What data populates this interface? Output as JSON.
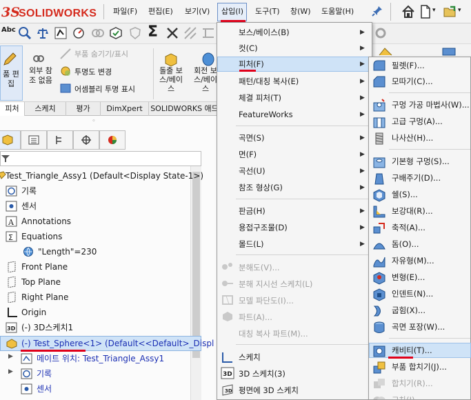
{
  "app": {
    "logo_ds": "3S",
    "logo_name": "SOLIDWORKS"
  },
  "menubar": [
    "파일(F)",
    "편집(E)",
    "보기(V)",
    "삽입(I)",
    "도구(T)",
    "창(W)",
    "도움말(H)"
  ],
  "toolbar1": {
    "abc_label": "Abc"
  },
  "ribbon": {
    "edit_part": "품 편\n집",
    "external_ref": "외부 참\n조 없음",
    "hide_show_parts": "부품 숨기기/표시",
    "change_transparency": "투명도 변경",
    "assembly_transparency": "어셈블리 투명 표시",
    "extrude_boss": "돌출 보\n스/베이\n스",
    "revolve_boss": "회전 보\n스/베이\n스"
  },
  "tabs": [
    "피처",
    "스케치",
    "평가",
    "DimXpert",
    "SOLIDWORKS 애드"
  ],
  "tree": [
    "Test_Triangle_Assy1  (Default<Display State-1>)",
    "기록",
    "센서",
    "Annotations",
    "Equations",
    "\"Length\"=230",
    "Front Plane",
    "Top Plane",
    "Right Plane",
    "Origin",
    "(-) 3D스케치1",
    "(-) Test_Sphere<1>  (Default<<Default>_Displ",
    "메이트 위치: Test_Triangle_Assy1",
    "기록",
    "센서"
  ],
  "insert_menu": [
    {
      "label": "보스/베이스(B)",
      "sub": true,
      "enabled": true
    },
    {
      "label": "컷(C)",
      "sub": true,
      "enabled": true
    },
    {
      "label": "피처(F)",
      "sub": true,
      "enabled": true
    },
    {
      "label": "패턴/대칭 복사(E)",
      "sub": true,
      "enabled": true
    },
    {
      "label": "체결 피처(T)",
      "sub": true,
      "enabled": true
    },
    {
      "label": "FeatureWorks",
      "sub": true,
      "enabled": true
    },
    {
      "label": "곡면(S)",
      "sub": true,
      "enabled": true
    },
    {
      "label": "면(F)",
      "sub": true,
      "enabled": true
    },
    {
      "label": "곡선(U)",
      "sub": true,
      "enabled": true
    },
    {
      "label": "참조 형상(G)",
      "sub": true,
      "enabled": true
    },
    {
      "label": "판금(H)",
      "sub": true,
      "enabled": true
    },
    {
      "label": "용접구조물(D)",
      "sub": true,
      "enabled": true
    },
    {
      "label": "몰드(L)",
      "sub": true,
      "enabled": true
    },
    {
      "label": "분해도(V)...",
      "sub": false,
      "enabled": false
    },
    {
      "label": "분해 지시선 스케치(L)",
      "sub": false,
      "enabled": false
    },
    {
      "label": "모델 파단도(I)...",
      "sub": false,
      "enabled": false
    },
    {
      "label": "파트(A)...",
      "sub": false,
      "enabled": false
    },
    {
      "label": "대칭 복사 파트(M)...",
      "sub": false,
      "enabled": false
    },
    {
      "label": "스케치",
      "sub": false,
      "enabled": true
    },
    {
      "label": "3D 스케치(3)",
      "sub": false,
      "enabled": true
    },
    {
      "label": "평면에 3D 스케치",
      "sub": false,
      "enabled": true
    }
  ],
  "feature_menu": [
    {
      "label": "필렛(F)...",
      "enabled": true
    },
    {
      "label": "모따기(C)...",
      "enabled": true
    },
    {
      "label": "구멍 가공 마법사(W)...",
      "enabled": true
    },
    {
      "label": "고급 구멍(A)...",
      "enabled": true
    },
    {
      "label": "나사산(H)...",
      "enabled": true
    },
    {
      "label": "기본형 구멍(S)...",
      "enabled": true
    },
    {
      "label": "구배주기(D)...",
      "enabled": true
    },
    {
      "label": "쉘(S)...",
      "enabled": true
    },
    {
      "label": "보강대(R)...",
      "enabled": true
    },
    {
      "label": "축적(A)...",
      "enabled": true
    },
    {
      "label": "돔(O)...",
      "enabled": true
    },
    {
      "label": "자유형(M)...",
      "enabled": true
    },
    {
      "label": "변형(E)...",
      "enabled": true
    },
    {
      "label": "인덴트(N)...",
      "enabled": true
    },
    {
      "label": "굽힘(X)...",
      "enabled": true
    },
    {
      "label": "곡면 포장(W)...",
      "enabled": true
    },
    {
      "label": "캐비티(T)...",
      "enabled": true
    },
    {
      "label": "부품 합치기(J)...",
      "enabled": true
    },
    {
      "label": "합치기(R)...",
      "enabled": false
    },
    {
      "label": "교차(I)...",
      "enabled": false
    }
  ],
  "colors": {
    "accent_red": "#e0001a",
    "highlight": "#cfe3f7",
    "logo_red": "#d52b1e"
  }
}
